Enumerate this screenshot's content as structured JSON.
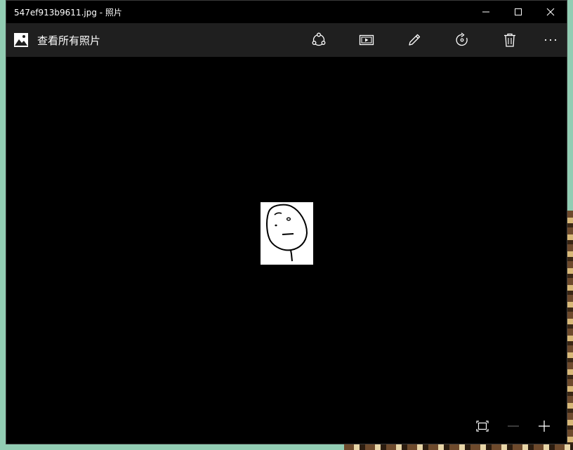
{
  "window": {
    "title": "547ef913b9611.jpg - 照片"
  },
  "toolbar": {
    "back_label": "查看所有照片",
    "buttons": [
      {
        "icon": "share-icon"
      },
      {
        "icon": "slideshow-icon"
      },
      {
        "icon": "edit-icon"
      },
      {
        "icon": "rotate-icon"
      },
      {
        "icon": "delete-icon"
      },
      {
        "icon": "more-icon"
      }
    ]
  },
  "viewer": {
    "image_description": "hand-drawn face sketch on white background"
  },
  "zoom_controls": {
    "icons": [
      "fit-to-window-icon",
      "zoom-out-icon",
      "zoom-in-icon"
    ]
  },
  "colors": {
    "window_bg": "#000000",
    "toolbar_bg": "#1f1f1f",
    "text": "#ffffff",
    "disabled": "#5a5a5a"
  }
}
